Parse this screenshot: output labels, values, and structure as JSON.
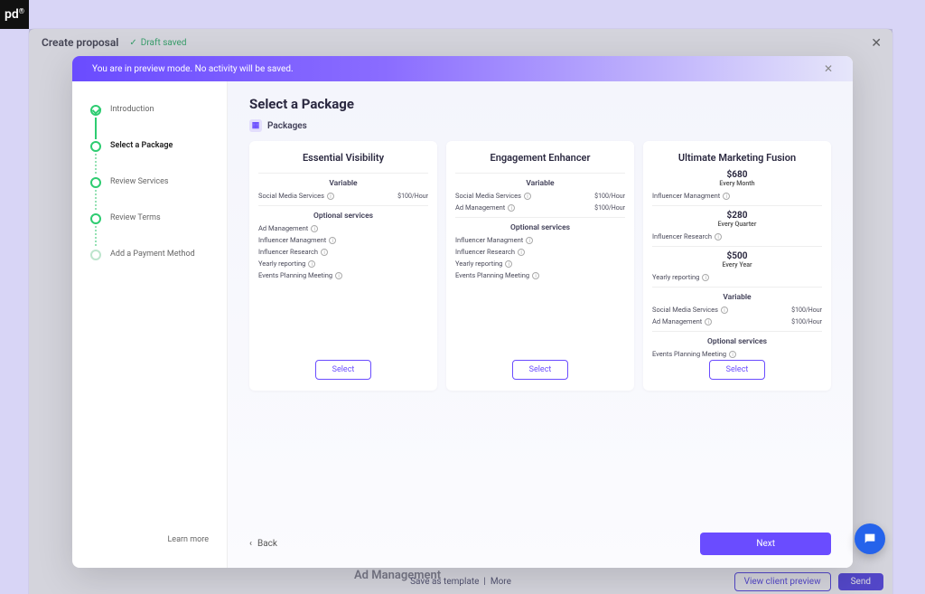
{
  "logo": "pd",
  "header": {
    "title": "Create proposal",
    "saved": "Draft saved"
  },
  "bg_item": "Ad Management",
  "footer": {
    "save_template": "Save as template",
    "more": "More",
    "view_client": "View client preview",
    "send": "Send"
  },
  "preview_bar": "You are in preview mode. No activity will be saved.",
  "steps": [
    {
      "label": "Introduction"
    },
    {
      "label": "Select a Package"
    },
    {
      "label": "Review Services"
    },
    {
      "label": "Review Terms"
    },
    {
      "label": "Add a Payment Method"
    }
  ],
  "learn_more": "Learn more",
  "page_title": "Select a Package",
  "crumb": "Packages",
  "variable_label": "Variable",
  "optional_label": "Optional services",
  "select_label": "Select",
  "back_label": "Back",
  "next_label": "Next",
  "packages": [
    {
      "name": "Essential Visibility",
      "variable": [
        {
          "label": "Social Media Services",
          "price": "$100/Hour"
        }
      ],
      "optional": [
        {
          "label": "Ad Management"
        },
        {
          "label": "Influencer Managment"
        },
        {
          "label": "Influencer Research"
        },
        {
          "label": "Yearly reporting"
        },
        {
          "label": "Events Planning Meeting"
        }
      ]
    },
    {
      "name": "Engagement Enhancer",
      "variable": [
        {
          "label": "Social Media Services",
          "price": "$100/Hour"
        },
        {
          "label": "Ad Management",
          "price": "$100/Hour"
        }
      ],
      "optional": [
        {
          "label": "Influencer Managment"
        },
        {
          "label": "Influencer Research"
        },
        {
          "label": "Yearly reporting"
        },
        {
          "label": "Events Planning Meeting"
        }
      ]
    },
    {
      "name": "Ultimate Marketing Fusion",
      "fixed": [
        {
          "price": "$680",
          "per": "Every Month",
          "below": "Influencer Managment"
        },
        {
          "price": "$280",
          "per": "Every Quarter",
          "below": "Influencer Research"
        },
        {
          "price": "$500",
          "per": "Every Year",
          "below": "Yearly reporting"
        }
      ],
      "variable": [
        {
          "label": "Social Media Services",
          "price": "$100/Hour"
        },
        {
          "label": "Ad Management",
          "price": "$100/Hour"
        }
      ],
      "optional": [
        {
          "label": "Events Planning Meeting"
        }
      ]
    }
  ]
}
